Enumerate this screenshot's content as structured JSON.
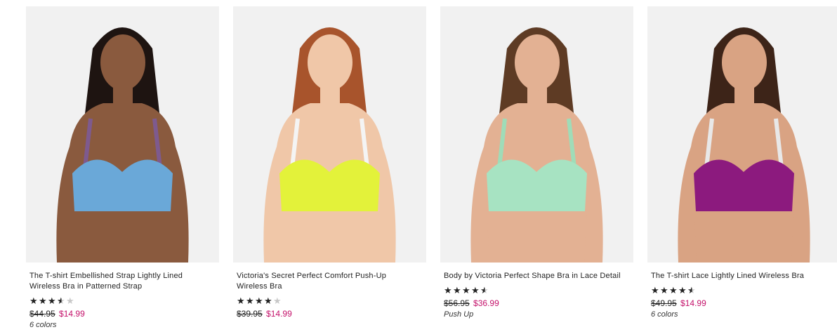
{
  "products": [
    {
      "title": "The T-shirt Embellished Strap Lightly Lined Wireless Bra in Patterned Strap",
      "rating": 3.5,
      "was_price": "$44.95",
      "sale_price": "$14.99",
      "note": "6 colors",
      "bra_color": "#6aa8d8",
      "strap_color": "#7e5a8e",
      "skin_color": "#8a5a3e",
      "hair_color": "#1e1411"
    },
    {
      "title": "Victoria's Secret Perfect Comfort Push-Up Wireless Bra",
      "rating": 4,
      "was_price": "$39.95",
      "sale_price": "$14.99",
      "note": "",
      "bra_color": "#e3f23a",
      "strap_color": "#f4f4f4",
      "skin_color": "#f0c7a8",
      "hair_color": "#a8542c"
    },
    {
      "title": "Body by Victoria Perfect Shape Bra in Lace Detail",
      "rating": 4.5,
      "was_price": "$56.95",
      "sale_price": "$36.99",
      "note": "Push Up",
      "bra_color": "#a7e3c2",
      "strap_color": "#9fdcb8",
      "skin_color": "#e3b193",
      "hair_color": "#5e3b24"
    },
    {
      "title": "The T-shirt Lace Lightly Lined Wireless Bra",
      "rating": 4.5,
      "was_price": "$49.95",
      "sale_price": "$14.99",
      "note": "6 colors",
      "bra_color": "#8c1a7e",
      "strap_color": "#e8e8e8",
      "skin_color": "#d9a383",
      "hair_color": "#3d2418"
    }
  ],
  "colors": {
    "sale": "#c4126b",
    "star_on": "#222222",
    "star_off": "#c8c8c8"
  }
}
